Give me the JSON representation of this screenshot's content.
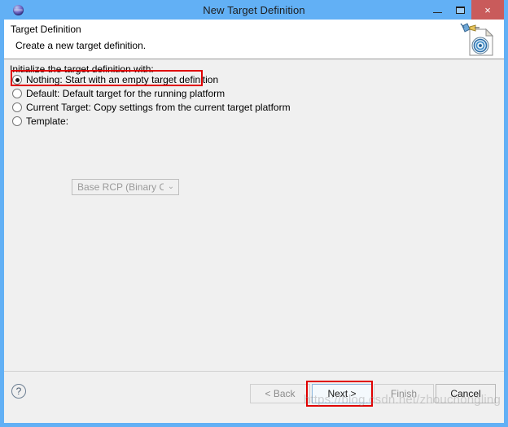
{
  "window": {
    "title": "New Target Definition",
    "app_icon": "eclipse-sphere-icon",
    "caption": {
      "minimize_label": "–",
      "maximize_label": "□",
      "close_label": "×"
    }
  },
  "header": {
    "title": "Target Definition",
    "subtitle": "Create a new target definition.",
    "icon": "target-definition-document-icon"
  },
  "main": {
    "group_label": "Initialize the target definition with:",
    "options": [
      {
        "label": "Nothing: Start with an empty target definition",
        "selected": true,
        "enabled": true,
        "highlighted": true
      },
      {
        "label": "Default: Default target for the running platform",
        "selected": false,
        "enabled": true,
        "highlighted": false
      },
      {
        "label": "Current Target: Copy settings from the current target platform",
        "selected": false,
        "enabled": true,
        "highlighted": false
      },
      {
        "label": "Template:",
        "selected": false,
        "enabled": true,
        "highlighted": false
      }
    ],
    "template_combo": {
      "value": "Base RCP (Binary Only)",
      "arrow": "⌄",
      "enabled": false
    }
  },
  "footer": {
    "help_label": "?",
    "buttons": [
      {
        "label": "< Back",
        "enabled": false,
        "is_default": false
      },
      {
        "label": "Next >",
        "enabled": true,
        "is_default": true
      },
      {
        "label": "Finish",
        "enabled": false,
        "is_default": false
      },
      {
        "label": "Cancel",
        "enabled": true,
        "is_default": false
      }
    ]
  },
  "watermark": {
    "text": "https://blog.csdn.net/zhouchongling"
  },
  "colors": {
    "titlebar": "#62b0f5",
    "close_button": "#c95b5b",
    "dialog_background": "#f0f0f0",
    "header_background": "#ffffff",
    "highlight_outline": "#e00000",
    "default_button_border": "#8ab6dd"
  }
}
